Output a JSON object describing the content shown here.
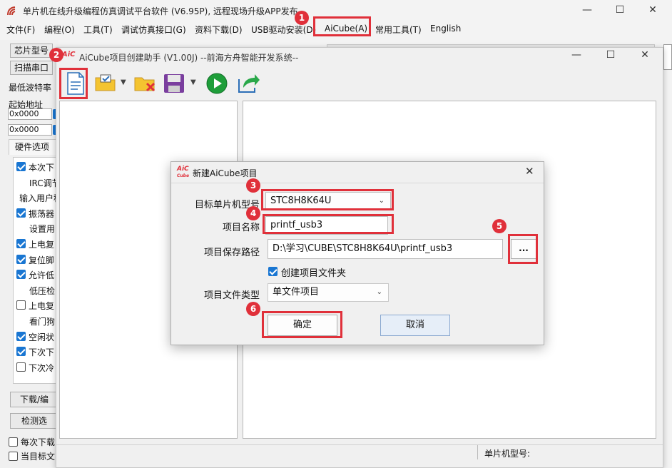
{
  "app": {
    "title": "单片机在线升级编程仿真调试平台软件 (V6.95P), 远程现场升级APP发布",
    "menu": [
      "文件(F)",
      "编程(O)",
      "工具(T)",
      "调试仿真接口(G)",
      "资料下载(D)",
      "USB驱动安装(D)",
      "AiCube(A)",
      "常用工具(T)",
      "English"
    ]
  },
  "left_panel": {
    "chip_type_btn": "芯片型号",
    "scan_port_btn": "扫描串口",
    "min_baud": "最低波特率",
    "start_addr": "起始地址",
    "addr1": "0x0000",
    "addr2": "0x0000",
    "hw_options_tab": "硬件选项",
    "options": [
      {
        "label": "本次下",
        "checked": true,
        "indent": false
      },
      {
        "label": "IRC调节",
        "checked": null,
        "indent": true
      },
      {
        "label": "输入用户程",
        "checked": null,
        "indent": false
      },
      {
        "label": "振荡器",
        "checked": true,
        "indent": false
      },
      {
        "label": "设置用",
        "checked": null,
        "indent": true
      },
      {
        "label": "上电复",
        "checked": true,
        "indent": false
      },
      {
        "label": "复位脚",
        "checked": true,
        "indent": false
      },
      {
        "label": "允许低",
        "checked": true,
        "indent": false
      },
      {
        "label": "低压检",
        "checked": null,
        "indent": true
      },
      {
        "label": "上电复",
        "checked": false,
        "indent": false
      },
      {
        "label": "看门狗",
        "checked": null,
        "indent": true
      },
      {
        "label": "空闲状",
        "checked": true,
        "indent": false
      },
      {
        "label": "下次下",
        "checked": true,
        "indent": false
      },
      {
        "label": "下次冷",
        "checked": false,
        "indent": false
      }
    ],
    "download_btn": "下载/编",
    "detect_btn": "检测选",
    "each_download": "每次下载",
    "current_target": "当目标文"
  },
  "helper": {
    "title": "AiCube项目创建助手 (V1.00J) --前海方舟智能开发系统--",
    "status_label": "单片机型号:"
  },
  "dialog": {
    "title": "新建AiCube项目",
    "mcu_label": "目标单片机型号",
    "mcu_value": "STC8H8K64U",
    "name_label": "项目名称",
    "name_value": "printf_usb3",
    "path_label": "项目保存路径",
    "path_value": "D:\\学习\\CUBE\\STC8H8K64U\\printf_usb3",
    "browse_label": "...",
    "create_folder_label": "创建项目文件夹",
    "create_folder_checked": true,
    "type_label": "项目文件类型",
    "type_value": "单文件项目",
    "ok_label": "确定",
    "cancel_label": "取消"
  },
  "annotations": [
    "1",
    "2",
    "3",
    "4",
    "5",
    "6"
  ],
  "colors": {
    "accent": "#1976d2",
    "annotation": "#e0303a",
    "brand": "#e0303a"
  }
}
